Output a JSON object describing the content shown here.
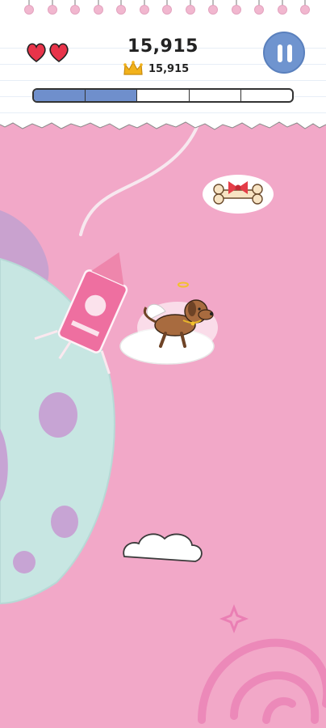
{
  "hud": {
    "score": "15,915",
    "best_score": "15,915",
    "lives": 2,
    "progress_segments_total": 5,
    "progress_segments_filled": 2
  },
  "colors": {
    "background": "#f3a9c9",
    "accent_blue": "#6f94cf",
    "heart": "#e8344a",
    "crown": "#f2b21b"
  },
  "icons": {
    "lives": "heart-icon",
    "best": "crown-icon",
    "pause": "pause-icon"
  }
}
